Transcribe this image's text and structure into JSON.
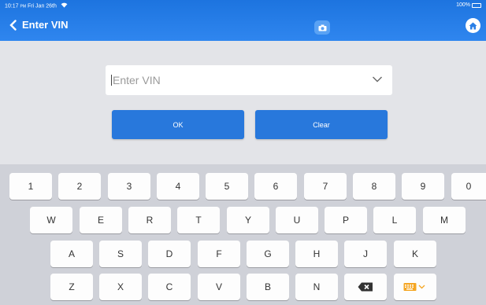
{
  "status_bar": {
    "time": "10:17",
    "ampm": "PM",
    "date": "Fri Jan 26th",
    "battery": "100%"
  },
  "header": {
    "title": "Enter VIN"
  },
  "vin": {
    "placeholder": "Enter VIN"
  },
  "buttons": {
    "ok": "OK",
    "clear": "Clear"
  },
  "keyboard": {
    "row1": [
      "1",
      "2",
      "3",
      "4",
      "5",
      "6",
      "7",
      "8",
      "9",
      "0"
    ],
    "row2": [
      "W",
      "E",
      "R",
      "T",
      "Y",
      "U",
      "P",
      "L",
      "M"
    ],
    "row3": [
      "A",
      "S",
      "D",
      "F",
      "G",
      "H",
      "J",
      "K"
    ],
    "row4": [
      "Z",
      "X",
      "C",
      "V",
      "B",
      "N"
    ]
  },
  "colors": {
    "header": "#1d74df",
    "button": "#2878dc",
    "keyboard_bg": "#cfd1d8",
    "key": "#fdfdfd"
  }
}
